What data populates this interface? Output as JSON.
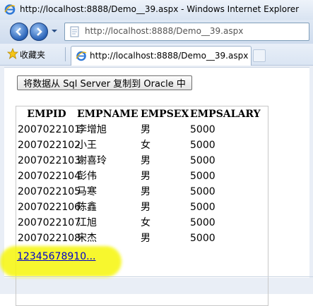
{
  "window": {
    "title": "http://localhost:8888/Demo__39.aspx - Windows Internet Explorer",
    "address": "http://localhost:8888/Demo__39.aspx"
  },
  "favorites": {
    "label": "收藏夹"
  },
  "tab": {
    "title": "http://localhost:8888/Demo__39.aspx"
  },
  "page": {
    "copy_button": "将数据从 Sql Server 复制到 Oracle 中",
    "columns": [
      "EMPID",
      "EMPNAME",
      "EMPSEX",
      "EMPSALARY"
    ],
    "rows": [
      [
        "2007022101",
        "李增旭",
        "男",
        "5000"
      ],
      [
        "2007022102",
        "小王",
        "女",
        "5000"
      ],
      [
        "2007022103",
        "谢喜玲",
        "男",
        "5000"
      ],
      [
        "2007022104",
        "彭伟",
        "男",
        "5000"
      ],
      [
        "2007022105",
        "马寒",
        "男",
        "5000"
      ],
      [
        "2007022106",
        "陈鑫",
        "男",
        "5000"
      ],
      [
        "2007022107",
        "江旭",
        "女",
        "5000"
      ],
      [
        "2007022108",
        "宋杰",
        "男",
        "5000"
      ]
    ],
    "pager": [
      "1",
      "2",
      "3",
      "4",
      "5",
      "6",
      "7",
      "8",
      "9",
      "10",
      "..."
    ]
  },
  "colors": {
    "highlight": "#f6f60a",
    "link": "#0000cc"
  }
}
